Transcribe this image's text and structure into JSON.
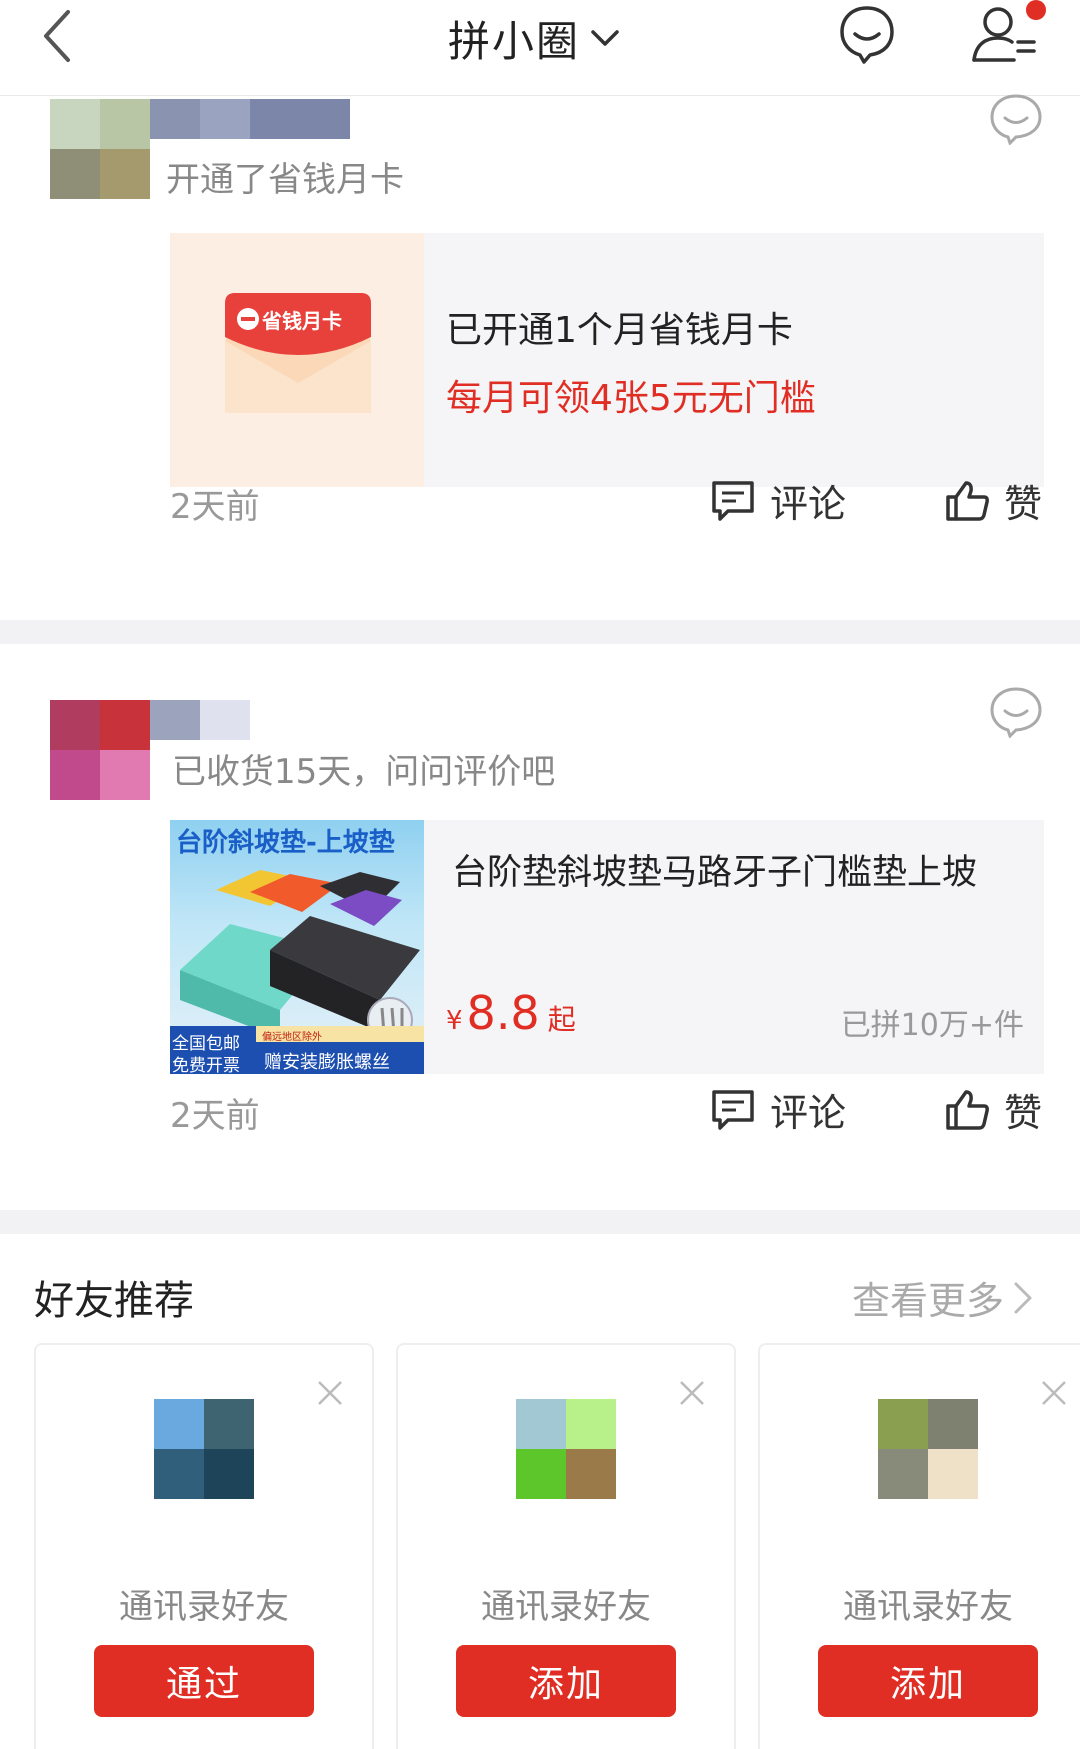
{
  "header": {
    "title": "拼小圈",
    "back_icon": "back-arrow-icon",
    "message_icon": "chat-bubble-icon",
    "profile_icon": "user-list-icon",
    "notification_dot_color": "#e02e24"
  },
  "feed": [
    {
      "activity_text": "开通了省钱月卡",
      "card": {
        "badge_text": "省钱月卡",
        "line1": "已开通1个月省钱月卡",
        "line2": "每月可领4张5元无门槛"
      },
      "time": "2天前",
      "comment_label": "评论",
      "like_label": "赞"
    },
    {
      "activity_text": "已收货15天，问问评价吧",
      "card": {
        "thumb_title": "台阶斜坡垫-上坡垫",
        "thumb_badge_left1": "全国包邮",
        "thumb_badge_left2": "免费开票",
        "thumb_badge_small": "偏远地区除外",
        "thumb_badge_right": "赠安装膨胀螺丝",
        "product_name": "台阶垫斜坡垫马路牙子门槛垫上坡",
        "price_symbol": "¥",
        "price": "8.8",
        "price_suffix": "起",
        "sold": "已拼10万+件"
      },
      "time": "2天前",
      "comment_label": "评论",
      "like_label": "赞"
    }
  ],
  "friends": {
    "title": "好友推荐",
    "see_more": "查看更多",
    "items": [
      {
        "label": "通讯录好友",
        "button": "通过"
      },
      {
        "label": "通讯录好友",
        "button": "添加"
      },
      {
        "label": "通讯录好友",
        "button": "添加"
      }
    ]
  },
  "colors": {
    "accent": "#e02e24",
    "card_bg": "#f5f5f7",
    "separator": "#f2f2f4"
  }
}
